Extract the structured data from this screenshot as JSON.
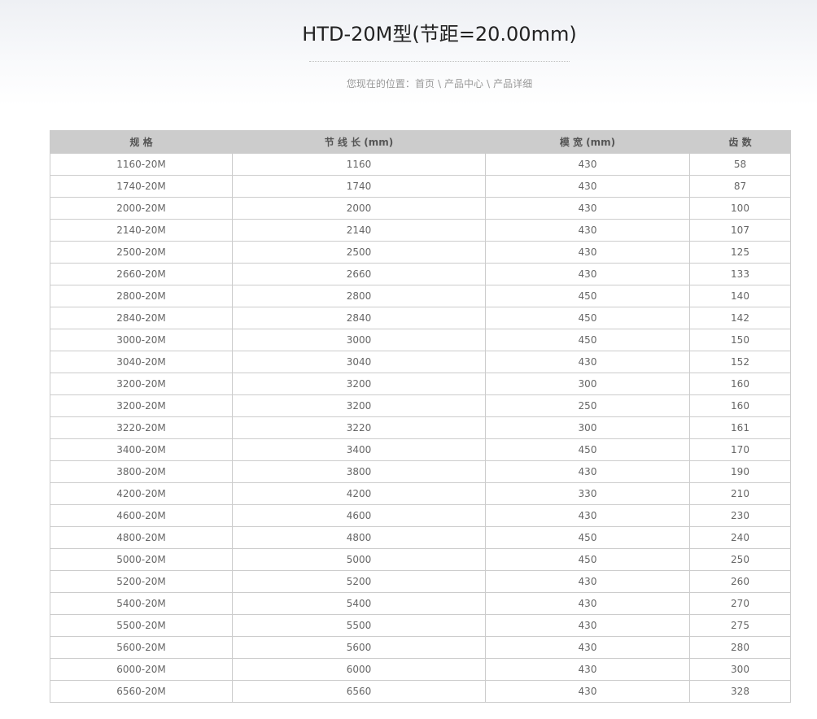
{
  "page": {
    "title": "HTD-20M型(节距=20.00mm)"
  },
  "breadcrumb": {
    "prefix": "您现在的位置：",
    "home": "首页",
    "separator": "\\",
    "category": "产品中心",
    "current": "产品详细"
  },
  "table": {
    "headers": [
      "规 格",
      "节 线 长 (mm)",
      "模 宽 (mm)",
      "齿 数"
    ],
    "rows": [
      [
        "1160-20M",
        "1160",
        "430",
        "58"
      ],
      [
        "1740-20M",
        "1740",
        "430",
        "87"
      ],
      [
        "2000-20M",
        "2000",
        "430",
        "100"
      ],
      [
        "2140-20M",
        "2140",
        "430",
        "107"
      ],
      [
        "2500-20M",
        "2500",
        "430",
        "125"
      ],
      [
        "2660-20M",
        "2660",
        "430",
        "133"
      ],
      [
        "2800-20M",
        "2800",
        "450",
        "140"
      ],
      [
        "2840-20M",
        "2840",
        "450",
        "142"
      ],
      [
        "3000-20M",
        "3000",
        "450",
        "150"
      ],
      [
        "3040-20M",
        "3040",
        "430",
        "152"
      ],
      [
        "3200-20M",
        "3200",
        "300",
        "160"
      ],
      [
        "3200-20M",
        "3200",
        "250",
        "160"
      ],
      [
        "3220-20M",
        "3220",
        "300",
        "161"
      ],
      [
        "3400-20M",
        "3400",
        "450",
        "170"
      ],
      [
        "3800-20M",
        "3800",
        "430",
        "190"
      ],
      [
        "4200-20M",
        "4200",
        "330",
        "210"
      ],
      [
        "4600-20M",
        "4600",
        "430",
        "230"
      ],
      [
        "4800-20M",
        "4800",
        "450",
        "240"
      ],
      [
        "5000-20M",
        "5000",
        "450",
        "250"
      ],
      [
        "5200-20M",
        "5200",
        "430",
        "260"
      ],
      [
        "5400-20M",
        "5400",
        "430",
        "270"
      ],
      [
        "5500-20M",
        "5500",
        "430",
        "275"
      ],
      [
        "5600-20M",
        "5600",
        "430",
        "280"
      ],
      [
        "6000-20M",
        "6000",
        "430",
        "300"
      ],
      [
        "6560-20M",
        "6560",
        "430",
        "328"
      ]
    ]
  },
  "colors": {
    "header_bg": "#cccccc",
    "border": "#cccccc",
    "title_text": "#222222",
    "body_text": "#666666",
    "breadcrumb_text": "#999999"
  }
}
